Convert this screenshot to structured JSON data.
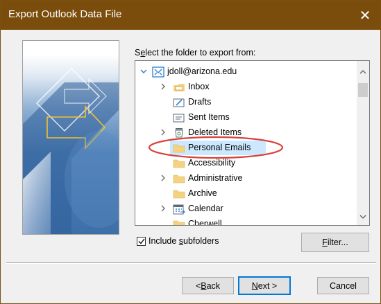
{
  "window": {
    "title": "Export Outlook Data File",
    "close_glyph": "✕"
  },
  "instruction": {
    "pre": "S",
    "underline": "e",
    "post": "lect the folder to export from:"
  },
  "tree": {
    "root": {
      "label": "jdoll@arizona.edu",
      "icon": "account-icon"
    },
    "items": [
      {
        "label": "Inbox",
        "icon": "inbox-icon",
        "expandable": true
      },
      {
        "label": "Drafts",
        "icon": "drafts-icon",
        "expandable": false
      },
      {
        "label": "Sent Items",
        "icon": "sent-items-icon",
        "expandable": false
      },
      {
        "label": "Deleted Items",
        "icon": "deleted-items-icon",
        "expandable": true
      },
      {
        "label": "Personal Emails",
        "icon": "folder-icon",
        "expandable": false,
        "selected": true
      },
      {
        "label": "Accessibility",
        "icon": "folder-icon",
        "expandable": false
      },
      {
        "label": "Administrative",
        "icon": "folder-icon",
        "expandable": true
      },
      {
        "label": "Archive",
        "icon": "folder-icon",
        "expandable": false
      },
      {
        "label": "Calendar",
        "icon": "calendar-icon",
        "expandable": true
      },
      {
        "label": "Cherwell",
        "icon": "folder-icon",
        "expandable": false
      }
    ]
  },
  "include_subfolders": {
    "pre": "Include ",
    "underline": "s",
    "post": "ubfolders",
    "checked": true
  },
  "buttons": {
    "filter": {
      "underline": "F",
      "post": "ilter..."
    },
    "back": {
      "pre": "< ",
      "underline": "B",
      "post": "ack"
    },
    "next": {
      "underline": "N",
      "post": "ext >"
    },
    "cancel": "Cancel"
  },
  "colors": {
    "titlebar": "#7a4d0c",
    "selection": "#cce8ff",
    "annotation": "#d9413a",
    "accent": "#0078d7"
  }
}
